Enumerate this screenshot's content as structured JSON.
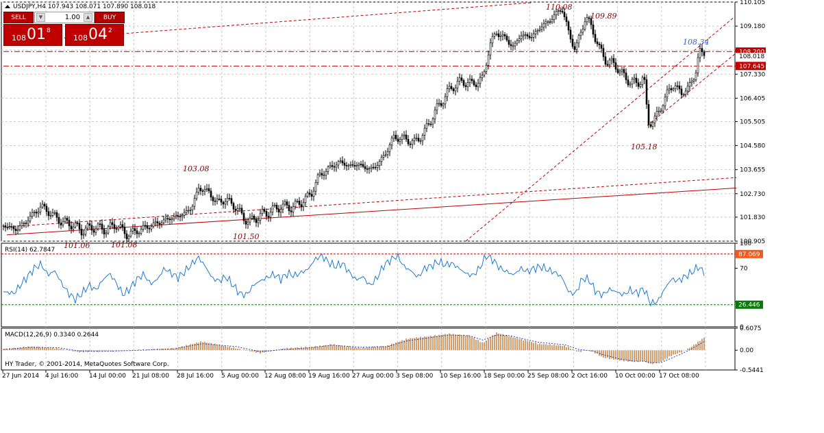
{
  "header": {
    "symbol_info": "USDJPY,H4  107.943 108.071 107.890 108.018"
  },
  "trade_panel": {
    "sell_label": "SELL",
    "buy_label": "BUY",
    "lot_value": "1.00",
    "sell_price_small": "108",
    "sell_price_big": "01",
    "sell_price_sup": "8",
    "buy_price_small": "108",
    "buy_price_big": "04",
    "buy_price_sup": "2"
  },
  "footer": {
    "copyright": "HY Trader, © 2001-2014, MetaQuotes Software Corp."
  },
  "colors": {
    "candle": "#000000",
    "grid": "#c8c8c8",
    "trendline": "#c00000",
    "rsi_line": "#1e78d2",
    "macd_hist": "#c8864b",
    "macd_signal": "#1e3cc8",
    "annotation": "#8b0000",
    "annotation_blue": "#3c5ad2",
    "current_price_bg": "#c00000",
    "rsi_high_bg": "#f05a1e",
    "rsi_low_bg": "#0a780a"
  },
  "chart_data": [
    {
      "type": "candlestick",
      "title": "USDJPY,H4",
      "ylim": [
        100.905,
        110.105
      ],
      "y_ticks": [
        "110.105",
        "109.180",
        "108.255",
        "107.330",
        "106.405",
        "105.505",
        "104.580",
        "103.655",
        "102.730",
        "101.830",
        "100.905"
      ],
      "current_price_label": "108.018",
      "price_levels": [
        {
          "label": "108.200",
          "value": 108.2
        },
        {
          "label": "107.645",
          "value": 107.645
        }
      ],
      "annotations": [
        {
          "text": "110.08",
          "value": 110.08,
          "color": "dark-red"
        },
        {
          "text": "109.89",
          "value": 109.89,
          "color": "dark-red"
        },
        {
          "text": "108.34",
          "value": 108.34,
          "color": "blue"
        },
        {
          "text": "103.08",
          "value": 103.08,
          "color": "dark-red"
        },
        {
          "text": "105.18",
          "value": 105.18,
          "color": "dark-red"
        },
        {
          "text": "101.50",
          "value": 101.5,
          "color": "dark-red"
        },
        {
          "text": "101.06",
          "value": 101.06,
          "color": "dark-red"
        },
        {
          "text": "101.08",
          "value": 101.08,
          "color": "dark-red"
        }
      ],
      "x_tick_labels": [
        "27 Jun 2014",
        "4 Jul 16:00",
        "14 Jul 00:00",
        "21 Jul 08:00",
        "28 Jul 16:00",
        "5 Aug 00:00",
        "12 Aug 08:00",
        "19 Aug 16:00",
        "27 Aug 00:00",
        "3 Sep 08:00",
        "10 Sep 16:00",
        "18 Sep 00:00",
        "25 Sep 08:00",
        "2 Oct 16:00",
        "10 Oct 00:00",
        "17 Oct 08:00"
      ],
      "close_path": [
        [
          0,
          101.5
        ],
        [
          20,
          101.35
        ],
        [
          40,
          101.85
        ],
        [
          55,
          102.25
        ],
        [
          70,
          101.95
        ],
        [
          85,
          101.65
        ],
        [
          100,
          101.55
        ],
        [
          115,
          101.3
        ],
        [
          130,
          101.45
        ],
        [
          150,
          101.35
        ],
        [
          165,
          101.55
        ],
        [
          180,
          101.15
        ],
        [
          195,
          101.3
        ],
        [
          210,
          101.45
        ],
        [
          225,
          101.6
        ],
        [
          240,
          101.75
        ],
        [
          260,
          101.9
        ],
        [
          275,
          102.2
        ],
        [
          285,
          102.95
        ],
        [
          300,
          102.8
        ],
        [
          310,
          102.4
        ],
        [
          325,
          102.5
        ],
        [
          340,
          102.2
        ],
        [
          350,
          101.8
        ],
        [
          360,
          101.65
        ],
        [
          375,
          101.9
        ],
        [
          390,
          102.05
        ],
        [
          405,
          102.25
        ],
        [
          420,
          102.2
        ],
        [
          435,
          102.4
        ],
        [
          450,
          102.75
        ],
        [
          460,
          103.4
        ],
        [
          475,
          103.7
        ],
        [
          490,
          103.95
        ],
        [
          505,
          103.8
        ],
        [
          520,
          103.85
        ],
        [
          535,
          103.65
        ],
        [
          550,
          103.95
        ],
        [
          560,
          104.4
        ],
        [
          570,
          104.9
        ],
        [
          585,
          104.85
        ],
        [
          600,
          104.7
        ],
        [
          615,
          105.1
        ],
        [
          625,
          105.65
        ],
        [
          640,
          106.3
        ],
        [
          655,
          106.85
        ],
        [
          670,
          107.05
        ],
        [
          685,
          106.95
        ],
        [
          700,
          107.15
        ],
        [
          710,
          108.45
        ],
        [
          720,
          108.95
        ],
        [
          735,
          108.65
        ],
        [
          745,
          108.35
        ],
        [
          755,
          108.85
        ],
        [
          770,
          108.75
        ],
        [
          785,
          109.15
        ],
        [
          800,
          109.45
        ],
        [
          815,
          109.9
        ],
        [
          825,
          108.95
        ],
        [
          835,
          108.25
        ],
        [
          850,
          109.55
        ],
        [
          860,
          109.05
        ],
        [
          870,
          108.3
        ],
        [
          880,
          107.85
        ],
        [
          895,
          107.65
        ],
        [
          905,
          107.25
        ],
        [
          915,
          107.05
        ],
        [
          925,
          106.95
        ],
        [
          935,
          107.25
        ],
        [
          941,
          105.45
        ],
        [
          950,
          105.55
        ],
        [
          960,
          106.05
        ],
        [
          970,
          106.65
        ],
        [
          980,
          106.95
        ],
        [
          990,
          106.55
        ],
        [
          1000,
          106.85
        ],
        [
          1010,
          107.25
        ],
        [
          1016,
          108.3
        ],
        [
          1025,
          108.02
        ]
      ],
      "trendlines": [
        {
          "from": [
            5,
            101.15
          ],
          "to": [
            1070,
            102.95
          ],
          "style": "solid"
        },
        {
          "from": [
            5,
            108.55
          ],
          "to": [
            770,
            110.08
          ],
          "style": "dashed"
        },
        {
          "from": [
            675,
            100.905
          ],
          "to": [
            1068,
            109.55
          ],
          "style": "dashed"
        },
        {
          "from": [
            940,
            105.35
          ],
          "to": [
            1070,
            108.15
          ],
          "style": "dashed"
        },
        {
          "from": [
            0,
            101.45
          ],
          "to": [
            1070,
            103.35
          ],
          "style": "dashed"
        },
        {
          "from": [
            0,
            108.2
          ],
          "to": [
            1070,
            108.2
          ],
          "style": "dash-dot"
        },
        {
          "from": [
            0,
            107.645
          ],
          "to": [
            1070,
            107.645
          ],
          "style": "dash-dot"
        }
      ]
    },
    {
      "type": "line",
      "title": "RSI(14) 62.7847",
      "ylim": [
        0,
        100
      ],
      "y_ticks": [
        "100",
        "70",
        "30",
        "0"
      ],
      "levels": [
        {
          "label": "87.069",
          "value": 87.069
        },
        {
          "label": "26.446",
          "value": 26.446
        }
      ],
      "series": [
        {
          "values_path": [
            [
              0,
              42
            ],
            [
              15,
              40
            ],
            [
              30,
              55
            ],
            [
              45,
              70
            ],
            [
              55,
              75
            ],
            [
              65,
              62
            ],
            [
              75,
              67
            ],
            [
              85,
              52
            ],
            [
              95,
              40
            ],
            [
              105,
              33
            ],
            [
              115,
              40
            ],
            [
              125,
              50
            ],
            [
              135,
              44
            ],
            [
              145,
              56
            ],
            [
              155,
              64
            ],
            [
              165,
              52
            ],
            [
              175,
              38
            ],
            [
              185,
              46
            ],
            [
              195,
              57
            ],
            [
              205,
              63
            ],
            [
              215,
              51
            ],
            [
              225,
              57
            ],
            [
              235,
              70
            ],
            [
              245,
              64
            ],
            [
              255,
              59
            ],
            [
              265,
              66
            ],
            [
              275,
              75
            ],
            [
              285,
              83
            ],
            [
              295,
              72
            ],
            [
              305,
              58
            ],
            [
              315,
              55
            ],
            [
              325,
              60
            ],
            [
              335,
              50
            ],
            [
              345,
              40
            ],
            [
              355,
              38
            ],
            [
              365,
              50
            ],
            [
              375,
              55
            ],
            [
              385,
              59
            ],
            [
              395,
              63
            ],
            [
              405,
              57
            ],
            [
              415,
              64
            ],
            [
              425,
              61
            ],
            [
              435,
              65
            ],
            [
              445,
              69
            ],
            [
              455,
              81
            ],
            [
              465,
              85
            ],
            [
              475,
              77
            ],
            [
              485,
              72
            ],
            [
              495,
              76
            ],
            [
              505,
              65
            ],
            [
              515,
              56
            ],
            [
              525,
              60
            ],
            [
              535,
              49
            ],
            [
              545,
              58
            ],
            [
              555,
              73
            ],
            [
              565,
              80
            ],
            [
              575,
              85
            ],
            [
              585,
              72
            ],
            [
              595,
              67
            ],
            [
              605,
              59
            ],
            [
              615,
              70
            ],
            [
              625,
              73
            ],
            [
              635,
              78
            ],
            [
              645,
              74
            ],
            [
              655,
              76
            ],
            [
              665,
              70
            ],
            [
              675,
              64
            ],
            [
              685,
              61
            ],
            [
              695,
              70
            ],
            [
              705,
              85
            ],
            [
              715,
              80
            ],
            [
              725,
              70
            ],
            [
              735,
              66
            ],
            [
              745,
              62
            ],
            [
              755,
              70
            ],
            [
              765,
              66
            ],
            [
              775,
              70
            ],
            [
              785,
              72
            ],
            [
              795,
              68
            ],
            [
              805,
              65
            ],
            [
              815,
              60
            ],
            [
              825,
              42
            ],
            [
              835,
              39
            ],
            [
              845,
              58
            ],
            [
              855,
              56
            ],
            [
              865,
              42
            ],
            [
              875,
              38
            ],
            [
              885,
              45
            ],
            [
              895,
              42
            ],
            [
              905,
              38
            ],
            [
              915,
              44
            ],
            [
              925,
              40
            ],
            [
              935,
              46
            ],
            [
              945,
              28
            ],
            [
              955,
              30
            ],
            [
              965,
              45
            ],
            [
              975,
              57
            ],
            [
              985,
              55
            ],
            [
              995,
              60
            ],
            [
              1005,
              65
            ],
            [
              1015,
              72
            ],
            [
              1025,
              63
            ]
          ]
        }
      ]
    },
    {
      "type": "bar",
      "title": "MACD(12,26,9) 0.3340 0.2644",
      "ylim": [
        -0.5441,
        0.6075
      ],
      "y_ticks": [
        "0.6075",
        "0.00",
        "-0.5441"
      ],
      "histogram_path": [
        [
          0,
          0.03
        ],
        [
          40,
          0.1
        ],
        [
          80,
          0.05
        ],
        [
          110,
          -0.05
        ],
        [
          150,
          -0.03
        ],
        [
          200,
          0.01
        ],
        [
          250,
          0.05
        ],
        [
          290,
          0.24
        ],
        [
          340,
          0.05
        ],
        [
          375,
          -0.08
        ],
        [
          410,
          0.05
        ],
        [
          450,
          0.09
        ],
        [
          480,
          0.16
        ],
        [
          520,
          0.06
        ],
        [
          560,
          0.12
        ],
        [
          590,
          0.32
        ],
        [
          620,
          0.38
        ],
        [
          650,
          0.45
        ],
        [
          680,
          0.4
        ],
        [
          700,
          0.2
        ],
        [
          720,
          0.48
        ],
        [
          740,
          0.38
        ],
        [
          780,
          0.18
        ],
        [
          820,
          0.12
        ],
        [
          840,
          -0.05
        ],
        [
          850,
          0.0
        ],
        [
          860,
          -0.03
        ],
        [
          875,
          -0.2
        ],
        [
          900,
          -0.28
        ],
        [
          920,
          -0.32
        ],
        [
          935,
          -0.3
        ],
        [
          945,
          -0.38
        ],
        [
          960,
          -0.32
        ],
        [
          975,
          -0.15
        ],
        [
          990,
          -0.05
        ],
        [
          1005,
          0.1
        ],
        [
          1025,
          0.38
        ]
      ],
      "signal_path": [
        [
          0,
          0.02
        ],
        [
          40,
          0.08
        ],
        [
          80,
          0.07
        ],
        [
          110,
          -0.02
        ],
        [
          150,
          -0.03
        ],
        [
          200,
          0.0
        ],
        [
          250,
          0.04
        ],
        [
          290,
          0.18
        ],
        [
          340,
          0.1
        ],
        [
          375,
          -0.04
        ],
        [
          410,
          0.02
        ],
        [
          450,
          0.07
        ],
        [
          480,
          0.14
        ],
        [
          520,
          0.08
        ],
        [
          560,
          0.1
        ],
        [
          590,
          0.26
        ],
        [
          620,
          0.34
        ],
        [
          650,
          0.42
        ],
        [
          680,
          0.4
        ],
        [
          700,
          0.28
        ],
        [
          720,
          0.42
        ],
        [
          740,
          0.4
        ],
        [
          780,
          0.22
        ],
        [
          820,
          0.15
        ],
        [
          840,
          0.02
        ],
        [
          860,
          -0.02
        ],
        [
          875,
          -0.12
        ],
        [
          900,
          -0.24
        ],
        [
          920,
          -0.3
        ],
        [
          935,
          -0.3
        ],
        [
          945,
          -0.34
        ],
        [
          960,
          -0.34
        ],
        [
          975,
          -0.22
        ],
        [
          990,
          -0.1
        ],
        [
          1005,
          0.04
        ],
        [
          1025,
          0.26
        ]
      ]
    }
  ]
}
